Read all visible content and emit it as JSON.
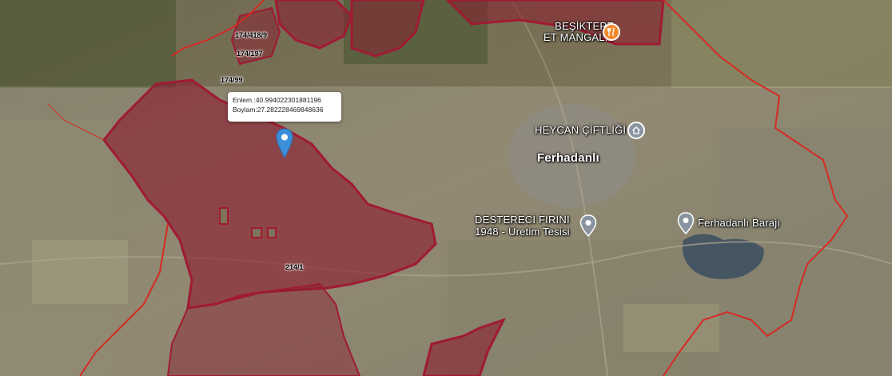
{
  "map": {
    "colors": {
      "parcel_fill": "#8a1c2e",
      "parcel_border": "#a01a33",
      "boundary_line": "#d62a22",
      "poi_orange": "#f28a2e",
      "poi_gray": "#8a94a0",
      "marker_blue": "#3b8fd9"
    }
  },
  "popup": {
    "lat_label": "Enlem",
    "lat_value": "40.994022301881196",
    "lon_label": "Boylam",
    "lon_value": "27.282228469848636",
    "lat_line": "Enlem :40.994022301881196",
    "lon_line": "Boylam:27.282228469848636"
  },
  "places": {
    "town": "Ferhadanlı",
    "restaurant_line1": "BEŞİKTEPE",
    "restaurant_line2": "ET MANGAL...",
    "farm": "HEYCAN ÇİFTLİĞİ",
    "bakery_line1": "DESTERECİ FIRINI",
    "bakery_line2": "1948 - Üretim Tesisi",
    "dam": "Ferhadanlı Barajı"
  },
  "parcels": {
    "p1": "174/418/9",
    "p2": "174/197",
    "p3": "174/99",
    "p4": "214/1"
  },
  "icons": {
    "restaurant": "fork-knife-icon",
    "farm": "house-icon",
    "bakery": "pin-icon",
    "dam": "pin-icon",
    "marker": "location-marker-icon"
  }
}
